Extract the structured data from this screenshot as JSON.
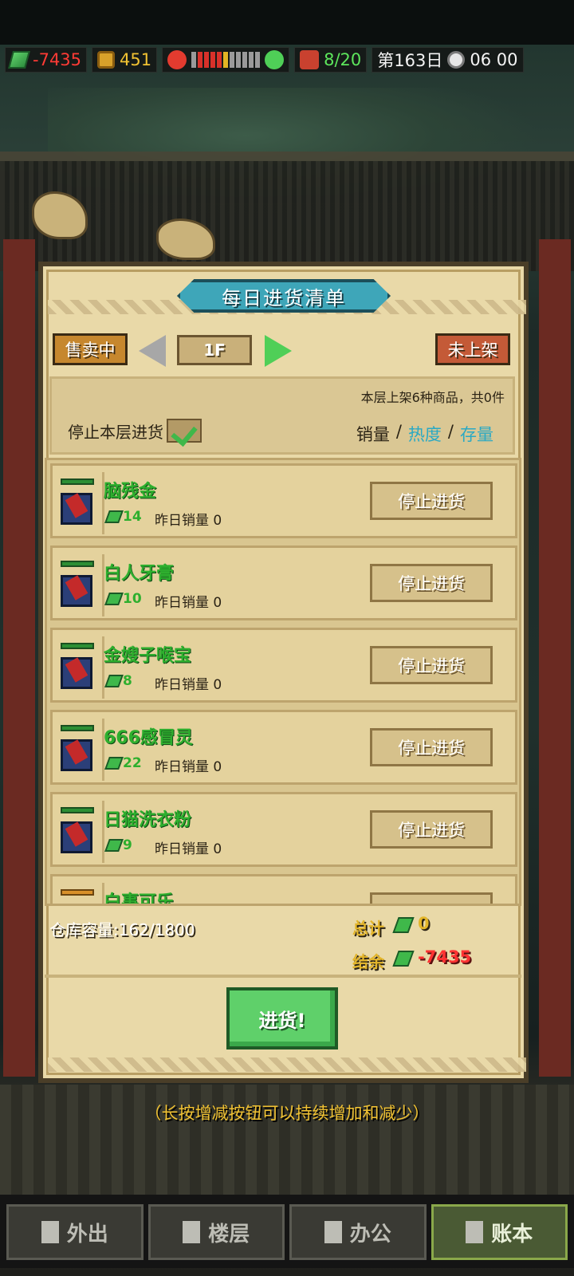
{
  "status_bar": {
    "money": "-7435",
    "coins": "451",
    "staff": "8/20",
    "day": "第163日",
    "time": "06 00",
    "icons": [
      "money-icon",
      "coin-icon",
      "angry-face-icon",
      "happy-face-icon",
      "person-icon",
      "clock-icon"
    ]
  },
  "panel": {
    "title": "每日进货清单",
    "selling_label": "售卖中",
    "floor": "1F",
    "unlisted_label": "未上架",
    "summary": "本层上架6种商品，共0件",
    "stop_floor_label": "停止本层进货",
    "sort": {
      "sales": "销量",
      "sep": "/",
      "heat": "热度",
      "stock": "存量"
    }
  },
  "items": [
    {
      "name": "脑残金",
      "price": "14",
      "sold_label": "昨日销量",
      "sold": "0",
      "button": "停止进货",
      "level": "green"
    },
    {
      "name": "白人牙膏",
      "price": "10",
      "sold_label": "昨日销量",
      "sold": "0",
      "button": "停止进货",
      "level": "green"
    },
    {
      "name": "金嫂子喉宝",
      "price": "8",
      "sold_label": "昨日销量",
      "sold": "0",
      "button": "停止进货",
      "level": "green"
    },
    {
      "name": "666感冒灵",
      "price": "22",
      "sold_label": "昨日销量",
      "sold": "0",
      "button": "停止进货",
      "level": "green"
    },
    {
      "name": "日猫洗衣粉",
      "price": "9",
      "sold_label": "昨日销量",
      "sold": "0",
      "button": "停止进货",
      "level": "green"
    },
    {
      "name": "白事可乐",
      "price": "",
      "sold_label": "",
      "sold": "",
      "button": "停止进货",
      "level": "orange"
    }
  ],
  "footer": {
    "capacity": "仓库容量:162/1800",
    "total_label": "总计",
    "total": "0",
    "balance_label": "结余",
    "balance": "-7435"
  },
  "buy_button": "进货!",
  "hint": "（长按增减按钮可以持续增加和减少）",
  "bottom_nav": [
    {
      "label": "外出",
      "icon": "exit-icon"
    },
    {
      "label": "楼层",
      "icon": "floors-icon"
    },
    {
      "label": "办公",
      "icon": "book-icon"
    },
    {
      "label": "账本",
      "icon": "ledger-icon"
    }
  ]
}
